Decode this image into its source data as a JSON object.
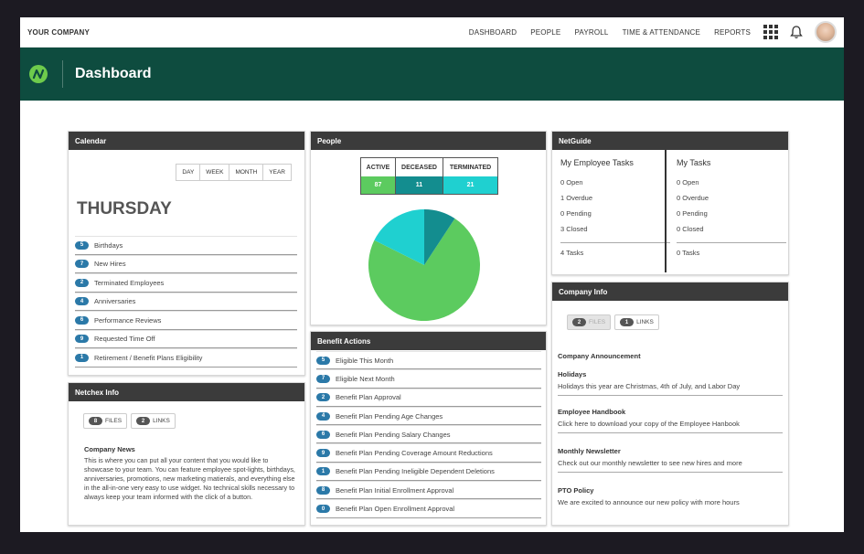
{
  "topbar": {
    "company": "YOUR COMPANY",
    "nav": [
      "DASHBOARD",
      "PEOPLE",
      "PAYROLL",
      "TIME & ATTENDANCE",
      "REPORTS"
    ]
  },
  "header": {
    "title": "Dashboard"
  },
  "colors": {
    "brand": "#0e4c3f",
    "badge": "#2b79a8",
    "active": "#5ccb5f",
    "deceased": "#138d8f",
    "terminated": "#1fd0d0"
  },
  "calendar": {
    "title": "Calendar",
    "views": [
      "DAY",
      "WEEK",
      "MONTH",
      "YEAR"
    ],
    "weekday": "THURSDAY",
    "items": [
      {
        "count": "5",
        "label": "Birthdays"
      },
      {
        "count": "7",
        "label": "New Hires"
      },
      {
        "count": "2",
        "label": "Terminated Employees"
      },
      {
        "count": "4",
        "label": "Anniversaries"
      },
      {
        "count": "6",
        "label": "Performance Reviews"
      },
      {
        "count": "9",
        "label": "Requested Time Off"
      },
      {
        "count": "1",
        "label": "Retirement / Benefit Plans Eligibility"
      }
    ]
  },
  "people": {
    "title": "People",
    "headers": [
      "ACTIVE",
      "DECEASED",
      "TERMINATED"
    ],
    "values": [
      "87",
      "11",
      "21"
    ]
  },
  "chart_data": {
    "type": "pie",
    "categories": [
      "ACTIVE",
      "DECEASED",
      "TERMINATED"
    ],
    "values": [
      87,
      11,
      21
    ],
    "colors": [
      "#5ccb5f",
      "#138d8f",
      "#1fd0d0"
    ]
  },
  "benefit": {
    "title": "Benefit Actions",
    "items": [
      {
        "count": "5",
        "label": "Eligible This Month"
      },
      {
        "count": "7",
        "label": "Eligible Next Month"
      },
      {
        "count": "2",
        "label": "Benefit Plan Approval"
      },
      {
        "count": "4",
        "label": "Benefit Plan Pending Age Changes"
      },
      {
        "count": "6",
        "label": "Benefit Plan Pending Salary Changes"
      },
      {
        "count": "9",
        "label": "Benefit Plan Pending Coverage Amount Reductions"
      },
      {
        "count": "1",
        "label": "Benefit Plan Pending Ineligible Dependent Deletions"
      },
      {
        "count": "8",
        "label": "Benefit Plan Initial Enrollment Approval"
      },
      {
        "count": "0",
        "label": "Benefit Plan Open Enrollment Approval"
      }
    ]
  },
  "netguide": {
    "title": "NetGuide",
    "employee": {
      "title": "My Employee Tasks",
      "rows": [
        "0 Open",
        "1 Overdue",
        "0 Pending",
        "3 Closed"
      ],
      "total": "4 Tasks"
    },
    "mine": {
      "title": "My Tasks",
      "rows": [
        "0 Open",
        "0 Overdue",
        "0 Pending",
        "0 Closed"
      ],
      "total": "0 Tasks"
    }
  },
  "company_info": {
    "title": "Company Info",
    "pills": [
      {
        "count": "2",
        "label": "FILES"
      },
      {
        "count": "1",
        "label": "LINKS"
      }
    ],
    "announcement": "Company Announcement",
    "sections": [
      {
        "title": "Holidays",
        "text": "Holidays this year are Christmas, 4th of July, and Labor Day"
      },
      {
        "title": "Employee Handbook",
        "text": "Click here to download your copy of the Employee Hanbook"
      },
      {
        "title": "Monthly Newsletter",
        "text": "Check out our monthly newsletter to see new hires and more"
      },
      {
        "title": "PTO Policy",
        "text": "We are excited to announce our new policy with more hours"
      }
    ]
  },
  "netchex": {
    "title": "Netchex Info",
    "pills": [
      {
        "count": "8",
        "label": "FILES"
      },
      {
        "count": "2",
        "label": "LINKS"
      }
    ],
    "news_title": "Company News",
    "news_text": "This is where you can put all your content that you would like to showcase to your team. You can feature employee spot-lights, birthdays, anniversaries, promotions, new marketing matierals, and everything else in the all-in-one very easy to use widget. No technical skills necessary to always keep your team informed with the click of a button."
  }
}
